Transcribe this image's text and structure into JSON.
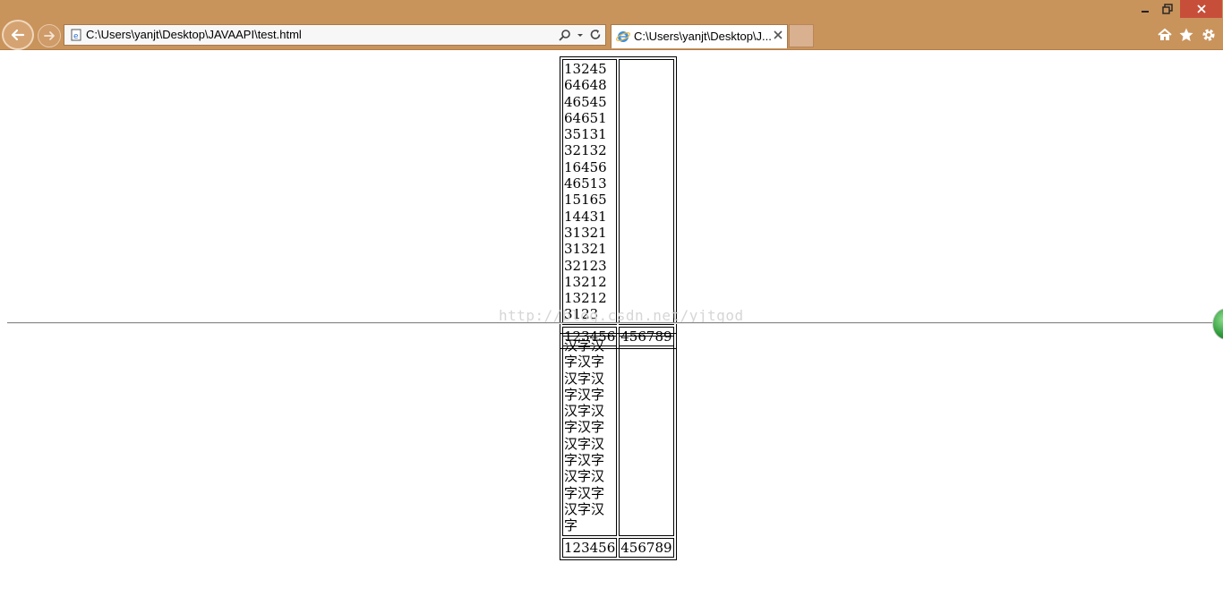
{
  "browser": {
    "address_url": "C:\\Users\\yanjt\\Desktop\\JAVAAPI\\test.html",
    "tab_title": "C:\\Users\\yanjt\\Desktop\\J...",
    "chrome_color": "#c9935c",
    "icons": [
      "back-arrow-icon",
      "forward-arrow-icon",
      "page-icon",
      "search-icon",
      "dropdown-arrow-icon",
      "refresh-icon",
      "ie-logo-icon",
      "close-tab-icon",
      "home-icon",
      "favorites-star-icon",
      "settings-gear-icon",
      "minimize-icon",
      "restore-icon",
      "close-window-icon"
    ]
  },
  "page": {
    "table1": {
      "cell_text": "1324564648465456465135131321321645646513151651443131321313213212313212132123123",
      "empty_cell": "",
      "footer": [
        "123456",
        "456789"
      ]
    },
    "watermark": "http://blog.csdn.net/yjtgod",
    "table2": {
      "cell_text": "汉字汉字汉字汉字汉字汉字汉字汉字汉字汉字汉字汉字汉字汉字汉字汉字汉字",
      "empty_cell": "",
      "footer": [
        "123456",
        "456789"
      ]
    }
  }
}
